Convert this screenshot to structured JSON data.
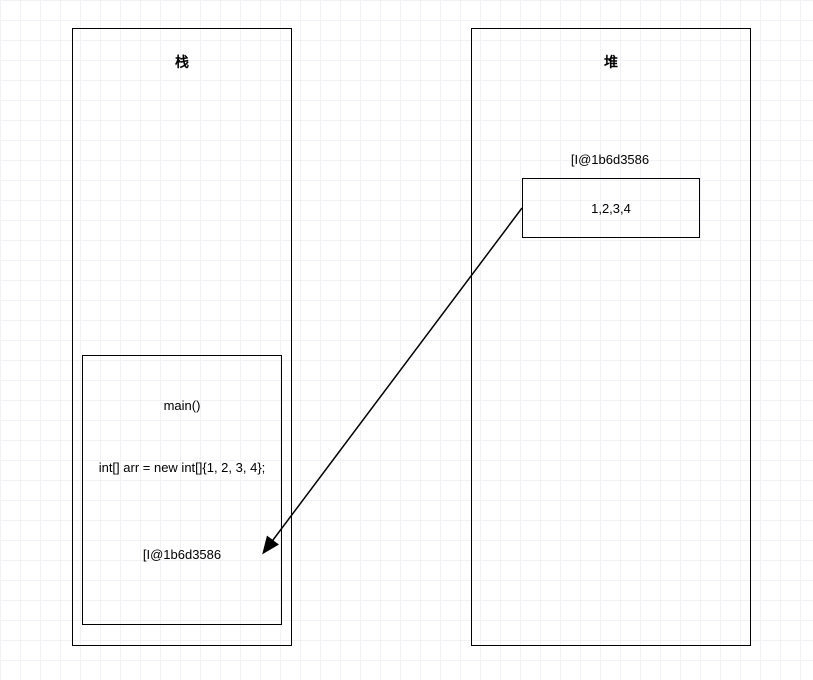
{
  "stack": {
    "title": "栈",
    "frame": {
      "name": "main()",
      "code": "int[] arr = new int[]{1, 2, 3, 4};",
      "ref": "[I@1b6d3586"
    }
  },
  "heap": {
    "title": "堆",
    "address": "[I@1b6d3586",
    "value": "1,2,3,4"
  }
}
